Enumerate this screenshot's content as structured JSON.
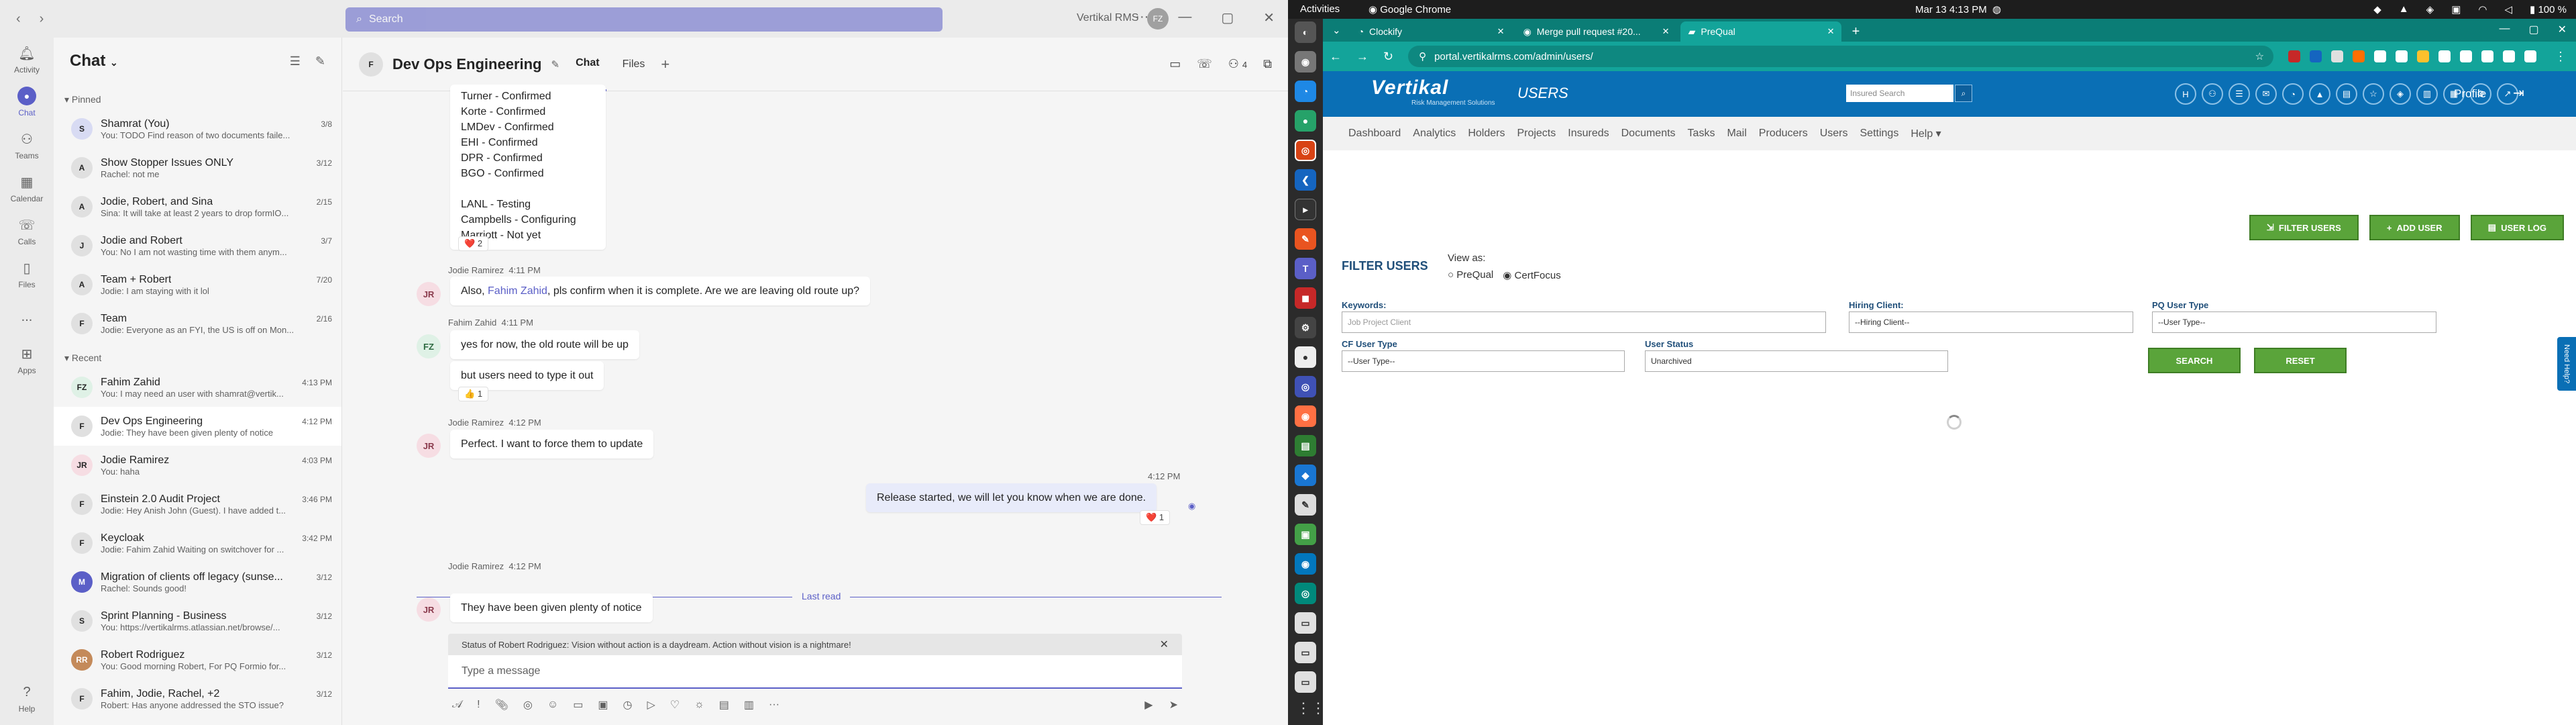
{
  "teams": {
    "search_placeholder": "Search",
    "org": "Vertikal RMS",
    "avatar_initials": "FZ",
    "rail": [
      {
        "label": "Activity"
      },
      {
        "label": "Chat"
      },
      {
        "label": "Teams"
      },
      {
        "label": "Calendar"
      },
      {
        "label": "Calls"
      },
      {
        "label": "Files"
      },
      {
        "label": "..."
      },
      {
        "label": "Apps"
      }
    ],
    "rail_help": "Help",
    "chatlist": {
      "title": "Chat",
      "pinned_label": "Pinned",
      "recent_label": "Recent",
      "pinned": [
        {
          "initials": "S",
          "name": "Shamrat (You)",
          "date": "3/8",
          "preview": "You: TODO Find reason of two documents faile...",
          "color": "#d8dbf3"
        },
        {
          "initials": "A",
          "name": "Show Stopper Issues ONLY",
          "date": "3/12",
          "preview": "Rachel: not me",
          "color": "#e0e0e0"
        },
        {
          "initials": "A",
          "name": "Jodie, Robert, and Sina",
          "date": "2/15",
          "preview": "Sina: It will take at least 2 years to drop formIO...",
          "color": "#e0e0e0"
        },
        {
          "initials": "J",
          "name": "Jodie and Robert",
          "date": "3/7",
          "preview": "You: No I am not wasting time with them anym...",
          "color": "#e0e0e0"
        },
        {
          "initials": "A",
          "name": "Team + Robert",
          "date": "7/20",
          "preview": "Jodie: I am staying with it lol",
          "color": "#e0e0e0"
        },
        {
          "initials": "F",
          "name": "Team",
          "date": "2/16",
          "preview": "Jodie: Everyone as an FYI, the US is off on Mon...",
          "color": "#e0e0e0"
        }
      ],
      "recent": [
        {
          "initials": "FZ",
          "name": "Fahim Zahid",
          "date": "4:13 PM",
          "preview": "You: I may need an user with shamrat@vertik...",
          "color": "#dff1e6"
        },
        {
          "initials": "F",
          "name": "Dev Ops Engineering",
          "date": "4:12 PM",
          "preview": "Jodie: They have been given plenty of notice",
          "color": "#e0e0e0",
          "selected": true
        },
        {
          "initials": "JR",
          "name": "Jodie Ramirez",
          "date": "4:03 PM",
          "preview": "You: haha",
          "color": "#f6dde3"
        },
        {
          "initials": "F",
          "name": "Einstein 2.0 Audit Project",
          "date": "3:46 PM",
          "preview": "Jodie: Hey Anish John (Guest). I have added t...",
          "color": "#e0e0e0"
        },
        {
          "initials": "F",
          "name": "Keycloak",
          "date": "3:42 PM",
          "preview": "Jodie: Fahim Zahid Waiting on switchover for ...",
          "color": "#e0e0e0"
        },
        {
          "initials": "M",
          "name": "Migration of clients off legacy (sunse...",
          "date": "3/12",
          "preview": "Rachel: Sounds good!",
          "color": "#5b5fc7"
        },
        {
          "initials": "S",
          "name": "Sprint Planning - Business",
          "date": "3/12",
          "preview": "You: https://vertikalrms.atlassian.net/browse/...",
          "color": "#e0e0e0"
        },
        {
          "initials": "RR",
          "name": "Robert Rodriguez",
          "date": "3/12",
          "preview": "You: Good morning Robert, For PQ Formio for...",
          "color": "#c48a5a"
        },
        {
          "initials": "F",
          "name": "Fahim, Jodie, Rachel, +2",
          "date": "3/12",
          "preview": "Robert: Has anyone addressed the STO issue?",
          "color": "#e0e0e0"
        }
      ]
    },
    "chat": {
      "title": "Dev Ops Engineering",
      "tabs": [
        "Chat",
        "Files"
      ],
      "participants": "4",
      "status_lines": [
        "Turner - Confirmed",
        "Korte - Confirmed",
        "LMDev - Confirmed",
        "EHI - Confirmed",
        "DPR - Confirmed",
        "BGO - Confirmed",
        "",
        "LANL - Testing",
        "Campbells - Configuring",
        "Marriott - Not yet"
      ],
      "status_reaction": "2",
      "messages": {
        "m1_author": "Jodie Ramirez",
        "m1_time": "4:11 PM",
        "m1_pre": "Also, ",
        "m1_mention": "Fahim Zahid",
        "m1_post": ", pls confirm when it is complete.  Are we are leaving old route up?",
        "m2_author": "Fahim Zahid",
        "m2_time": "4:11 PM",
        "m2_text1": "yes for now, the old route will be up",
        "m2_text2": "but users need to type it out",
        "m2_reaction": "1",
        "m3_author": "Jodie Ramirez",
        "m3_time": "4:12 PM",
        "m3_text": "Perfect.  I want to force them to update",
        "m4_time": "4:12 PM",
        "m4_text": "Release started, we will let you know when we are done.",
        "m4_reaction": "1",
        "last_read": "Last read",
        "m5_author": "Jodie Ramirez",
        "m5_time": "4:12 PM",
        "m5_text": "They have been given plenty of notice"
      },
      "status_notice": "Status of Robert Rodriguez: Vision without action is a daydream. Action without vision is a nightmare!",
      "compose_placeholder": "Type a message"
    }
  },
  "ubuntu": {
    "activities": "Activities",
    "app": "Google Chrome",
    "clock": "Mar 13  4:13 PM",
    "battery": "100 %"
  },
  "chrome": {
    "tabs": [
      {
        "title": "Clockify"
      },
      {
        "title": "Merge pull request #20..."
      },
      {
        "title": "PreQual",
        "active": true
      }
    ],
    "url": "portal.vertikalrms.com/admin/users/"
  },
  "portal": {
    "logo": "Vertikal",
    "logo_tag": "Risk Management Solutions",
    "page_title": "USERS",
    "insured_search_placeholder": "Insured Search",
    "profile": "Profile",
    "nav": [
      "Dashboard",
      "Analytics",
      "Holders",
      "Projects",
      "Insureds",
      "Documents",
      "Tasks",
      "Mail",
      "Producers",
      "Users",
      "Settings",
      "Help ▾"
    ],
    "buttons": {
      "filter": "FILTER USERS",
      "add": "ADD USER",
      "log": "USER LOG"
    },
    "filter_title": "FILTER USERS",
    "view_as": "View as:",
    "view_opts": [
      "PreQual",
      "CertFocus"
    ],
    "view_selected": "CertFocus",
    "fields": {
      "keywords_label": "Keywords:",
      "keywords_placeholder": "Job Project Client",
      "hiring_label": "Hiring Client:",
      "hiring_value": "--Hiring Client--",
      "pq_label": "PQ User Type",
      "pq_value": "--User Type--",
      "cf_label": "CF User Type",
      "cf_value": "--User Type--",
      "status_label": "User Status",
      "status_value": "Unarchived"
    },
    "search_btn": "SEARCH",
    "reset_btn": "RESET",
    "need_help": "Need Help?"
  }
}
